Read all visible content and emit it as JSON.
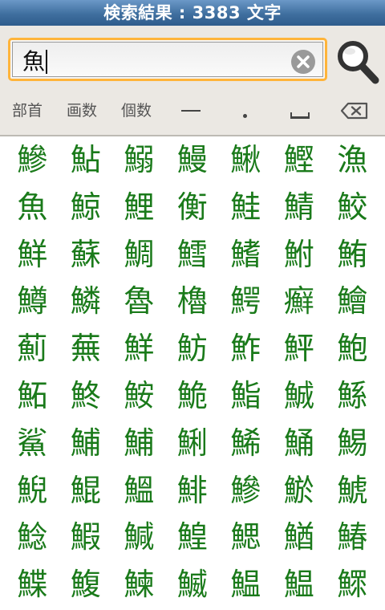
{
  "title": "検索結果 : 3383 文字",
  "search": {
    "value": "魚"
  },
  "filters": {
    "radical": "部首",
    "strokes": "画数",
    "count": "個数"
  },
  "icons": {
    "clear": "clear-circle-icon",
    "search": "magnifier-icon",
    "horizontal": "horizontal-bar-icon",
    "dot": "dot-icon",
    "space": "space-bar-icon",
    "backspace": "backspace-icon"
  },
  "colors": {
    "titlebar": "#3f6f9f",
    "accent": "#ffb43a",
    "kanji": "#1a7a1a"
  },
  "results": [
    "鰺",
    "鮎",
    "鰯",
    "鰻",
    "鰍",
    "鰹",
    "漁",
    "魚",
    "鯨",
    "鯉",
    "衡",
    "鮭",
    "鯖",
    "鮫",
    "鮮",
    "蘇",
    "鯛",
    "鱈",
    "鰭",
    "鮒",
    "鮪",
    "鱒",
    "鱗",
    "魯",
    "櫓",
    "鰐",
    "癬",
    "鱠",
    "薊",
    "蕪",
    "鮮",
    "魴",
    "鮓",
    "鮃",
    "鮑",
    "鮖",
    "鮗",
    "鮟",
    "鮠",
    "鮨",
    "鯎",
    "鯀",
    "鯊",
    "鯆",
    "鯆",
    "鯏",
    "鯑",
    "鯒",
    "鯣",
    "鯢",
    "鯤",
    "鰮",
    "鯡",
    "鰺",
    "鯲",
    "鯱",
    "鯰",
    "鰕",
    "鰔",
    "鰉",
    "鰓",
    "鰌",
    "鰆",
    "鰈",
    "鰒",
    "鰊",
    "鰄",
    "鰛",
    "鰛",
    "鰥"
  ]
}
